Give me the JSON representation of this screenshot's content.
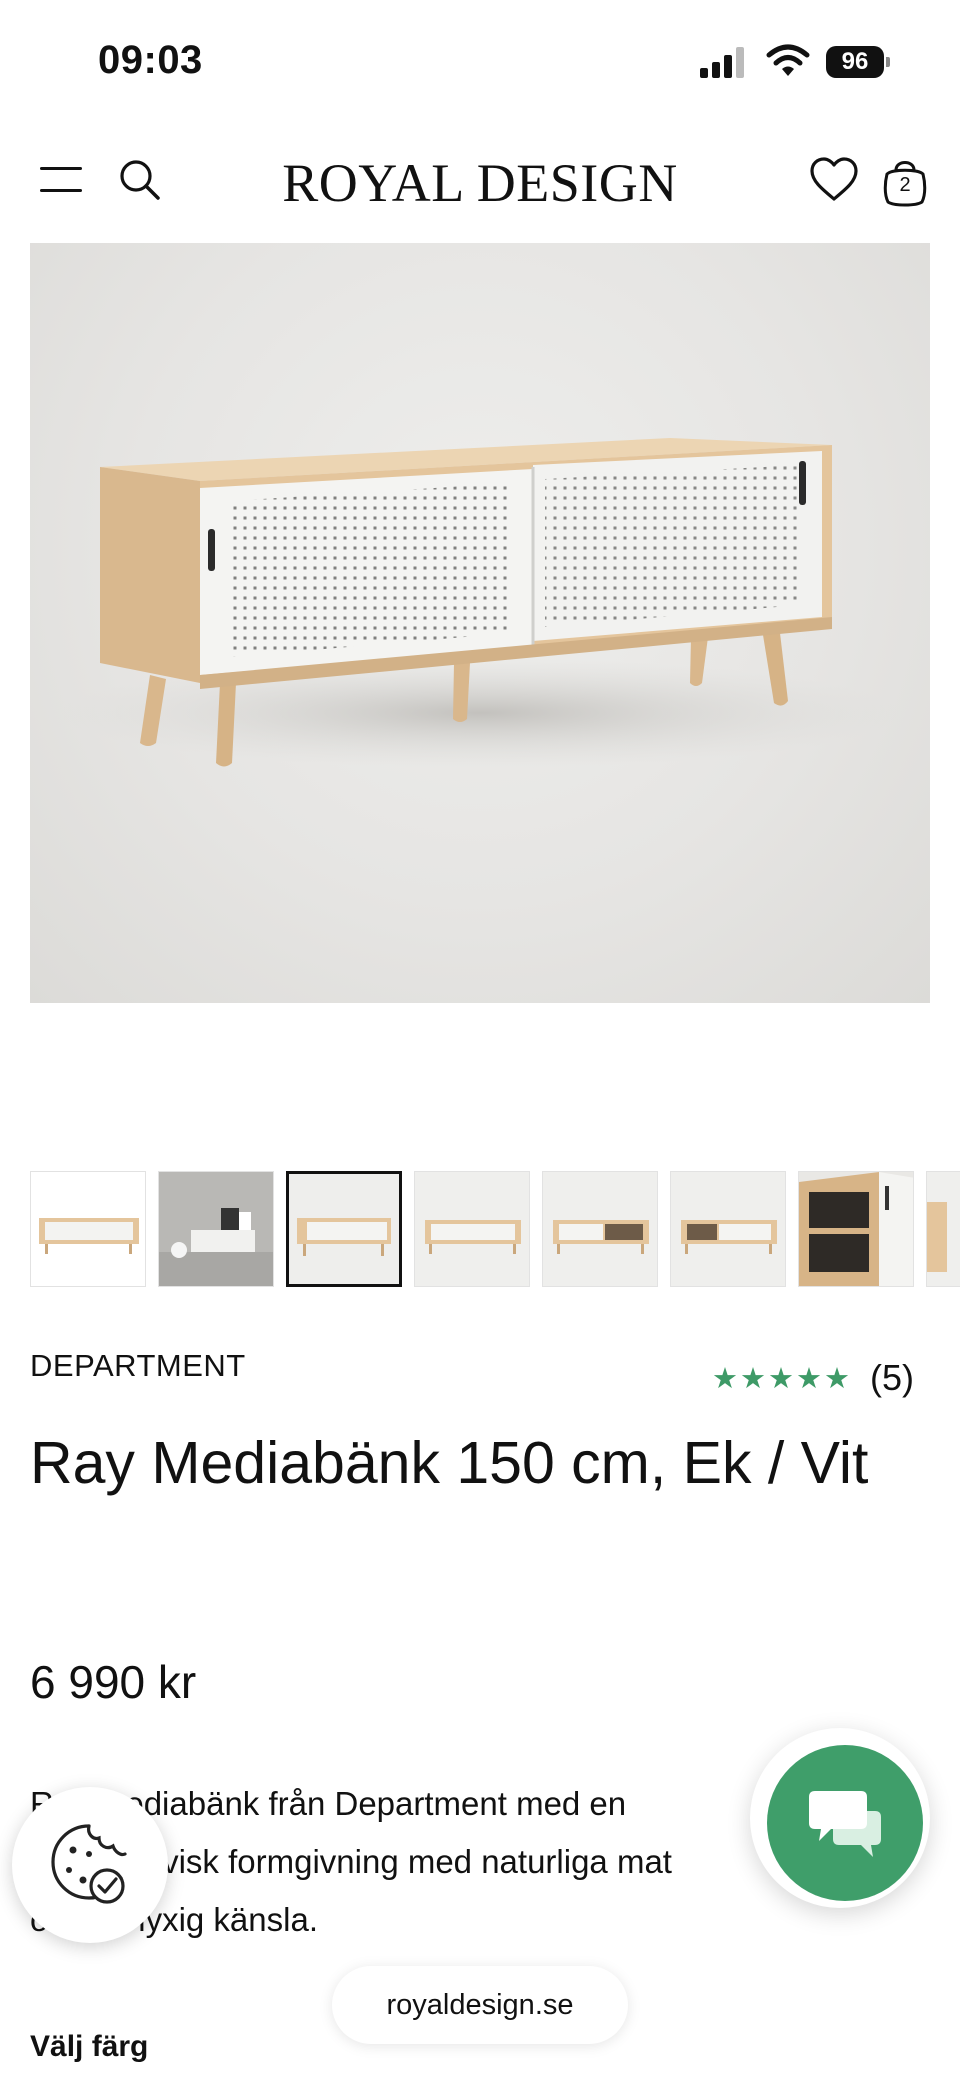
{
  "status_bar": {
    "time": "09:03",
    "battery": "96"
  },
  "header": {
    "logo": "ROYAL DESIGN",
    "menu_icon": "hamburger-menu-icon",
    "search_icon": "search-icon",
    "wishlist_icon": "heart-icon",
    "cart_icon": "shopping-bag-icon",
    "cart_count": "2"
  },
  "gallery": {
    "thumbnail_count": 8,
    "active_index": 2
  },
  "product": {
    "brand": "DEPARTMENT",
    "rating_stars": "★★★★★",
    "rating_value": 5,
    "review_count": "(5)",
    "title": "Ray Mediabänk 150 cm, Ek / Vit",
    "price": "6 990 kr",
    "description_lines": [
      "Ray mediabänk från Department med en",
      "skandinavisk formgivning med naturliga mat",
      "och en lyxig känsla."
    ],
    "choose_color_label": "Välj färg"
  },
  "floating": {
    "cookie_icon": "cookie-consent-icon",
    "chat_icon": "chat-bubbles-icon",
    "url": "royaldesign.se"
  },
  "colors": {
    "accent_green": "#3f9e6a",
    "star_green": "#3e9a67",
    "text": "#111111",
    "oak": "#e2c29a",
    "door_white": "#f4f4f2"
  }
}
